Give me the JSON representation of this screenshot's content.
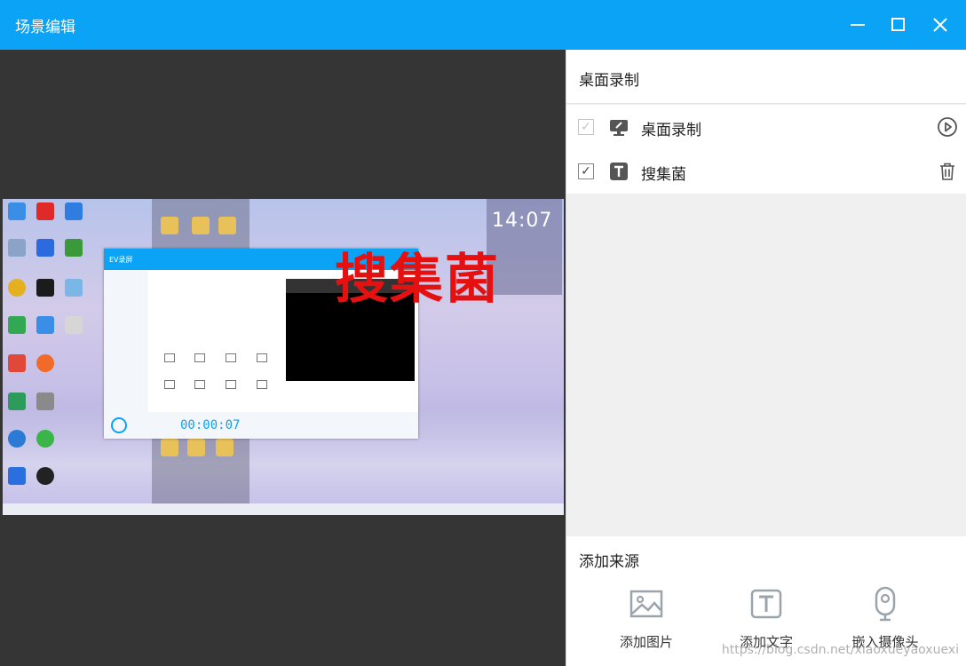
{
  "window": {
    "title": "场景编辑",
    "minimize_icon": "minimize-icon",
    "maximize_icon": "maximize-icon",
    "close_icon": "close-icon",
    "accent_color": "#0aa3f5"
  },
  "preview": {
    "overlay_text": "搜集菌",
    "overlay_color": "#e51010",
    "desktop_clock": "14:07",
    "recorder_window_title": "EV录屏",
    "recorder_timer": "00:00:07"
  },
  "scene": {
    "title": "桌面录制",
    "sources": [
      {
        "label": "桌面录制",
        "checked": true,
        "enabled": false,
        "icon": "monitor-icon",
        "action_icon": "play-circle-icon"
      },
      {
        "label": "搜集菌",
        "checked": true,
        "enabled": true,
        "icon": "text-icon",
        "action_icon": "trash-icon"
      }
    ]
  },
  "add_source": {
    "title": "添加来源",
    "buttons": [
      {
        "label": "添加图片",
        "icon": "image-icon"
      },
      {
        "label": "添加文字",
        "icon": "text-icon"
      },
      {
        "label": "嵌入摄像头",
        "icon": "webcam-icon"
      }
    ]
  },
  "watermark": "https://blog.csdn.net/xiaoxueyaoxuexi"
}
